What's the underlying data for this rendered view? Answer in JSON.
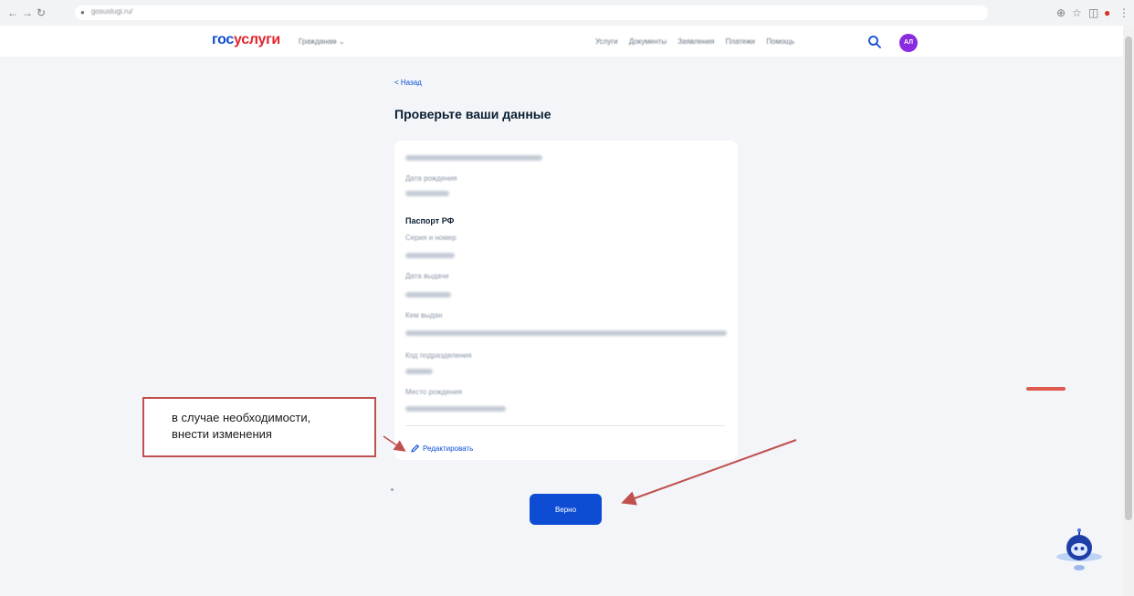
{
  "browser": {
    "back_glyph": "←",
    "forward_glyph": "→",
    "reload_glyph": "↻",
    "url": "gosuslugi.ru/",
    "ext_icons": [
      "⊕",
      "☆",
      "◫",
      "⋮"
    ]
  },
  "header": {
    "logo_part1": "гос",
    "logo_part2": "услуги",
    "menu_label": "Гражданам ⌄",
    "nav_links": [
      "Услуги",
      "Документы",
      "Заявления",
      "Платежи",
      "Помощь"
    ],
    "avatar_initials": "АЛ"
  },
  "main": {
    "back_link": "< Назад",
    "title": "Проверьте ваши данные",
    "fields": [
      {
        "label": "Дата рождения"
      },
      {
        "label": "Серия и номер"
      },
      {
        "label": "Дата выдачи"
      },
      {
        "label": "Кем выдан"
      },
      {
        "label": "Код подразделения"
      },
      {
        "label": "Место рождения"
      }
    ],
    "passport_section_title": "Паспорт РФ",
    "edit_link": "Редактировать",
    "submit_button": "Верно"
  },
  "annotation": {
    "callout_line1": "в случае необходимости,",
    "callout_line2": "внести изменения",
    "color": "#c0504d"
  },
  "colors": {
    "brand_blue": "#0d4cd3",
    "brand_red": "#e3242b",
    "avatar": "#8a2be2"
  }
}
